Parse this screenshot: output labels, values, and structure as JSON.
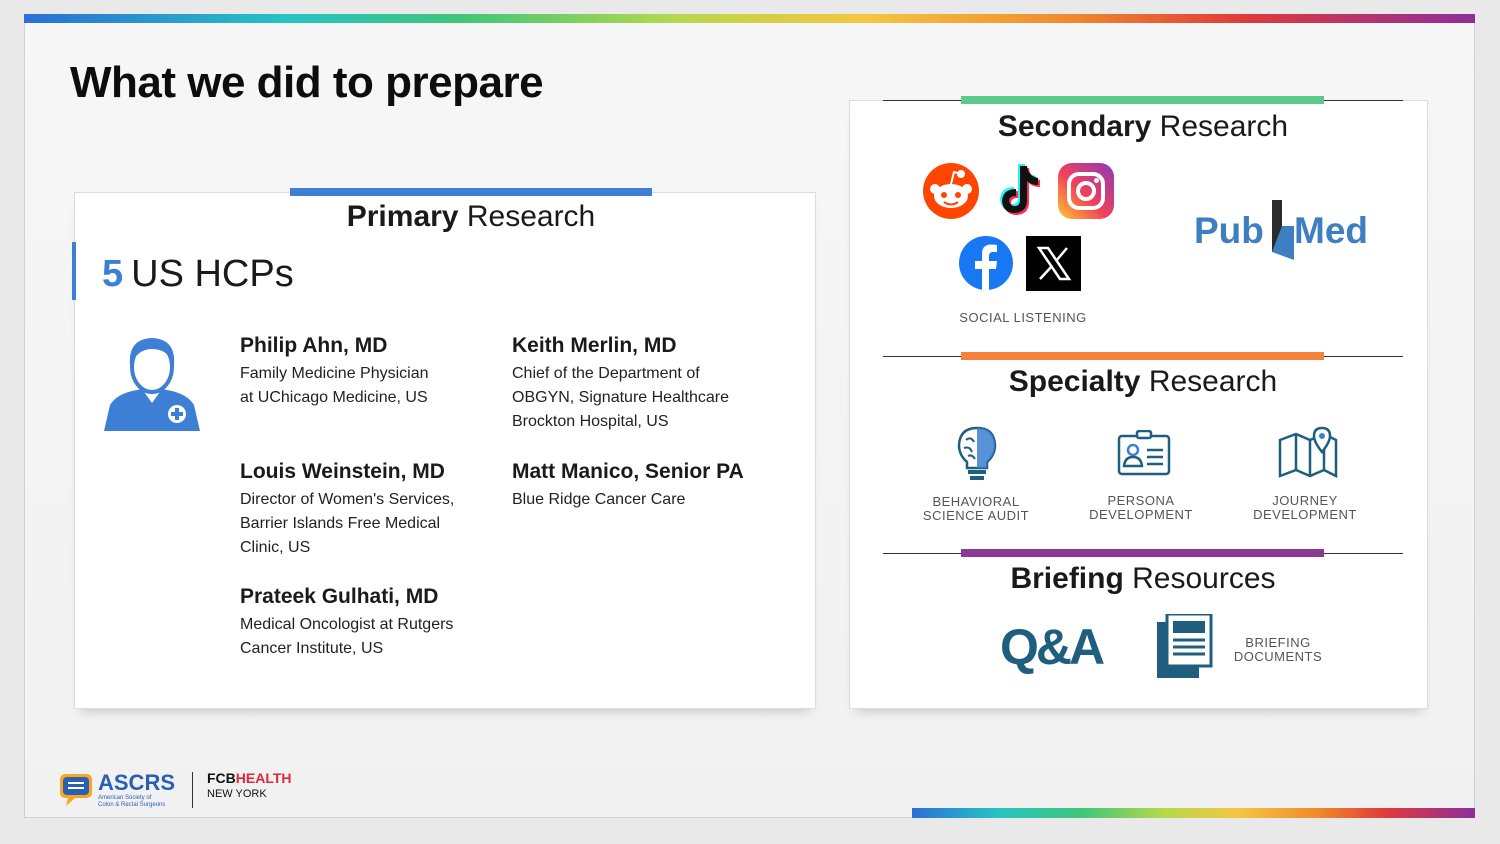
{
  "title": "What we did to prepare",
  "primary": {
    "heading_bold": "Primary",
    "heading_light": "Research",
    "count_number": "5",
    "count_label": "US HCPs",
    "people": [
      {
        "name": "Philip Ahn, MD",
        "desc": "Family Medicine Physician at UChicago Medicine, US"
      },
      {
        "name": "Keith Merlin, MD",
        "desc": "Chief of the Department of OBGYN, Signature Healthcare Brockton Hospital, US"
      },
      {
        "name": "Louis Weinstein, MD",
        "desc": "Director of Women's Services, Barrier Islands Free Medical Clinic, US"
      },
      {
        "name": "Matt Manico, Senior PA",
        "desc": "Blue Ridge Cancer Care"
      },
      {
        "name": "Prateek Gulhati, MD",
        "desc": "Medical Oncologist at Rutgers Cancer Institute, US"
      }
    ]
  },
  "secondary": {
    "heading_bold": "Secondary",
    "heading_light": "Research",
    "social_caption": "SOCIAL LISTENING",
    "pubmed_a": "Pub",
    "pubmed_b": "Med"
  },
  "specialty": {
    "heading_bold": "Specialty",
    "heading_light": "Research",
    "items": [
      {
        "line1": "BEHAVIORAL",
        "line2": "SCIENCE AUDIT"
      },
      {
        "line1": "PERSONA",
        "line2": "DEVELOPMENT"
      },
      {
        "line1": "JOURNEY",
        "line2": "DEVELOPMENT"
      }
    ]
  },
  "briefing": {
    "heading_bold": "Briefing",
    "heading_light": "Resources",
    "qa_label": "Q&A",
    "doc_line1": "BRIEFING",
    "doc_line2": "DOCUMENTS"
  },
  "footer": {
    "ascrs": "ASCRS",
    "ascrs_sub1": "American Society of",
    "ascrs_sub2": "Colon & Rectal Surgeons",
    "fcb_a": "FCB",
    "fcb_b": "HEALTH",
    "fcb_city": "NEW YORK"
  },
  "colors": {
    "primary_accent": "#3d7fd4",
    "secondary_accent": "#5cc98b",
    "specialty_accent": "#f4823a",
    "briefing_accent": "#8a3a93",
    "pubmed_blue": "#3e7fc1",
    "teal": "#1f5e7e"
  }
}
